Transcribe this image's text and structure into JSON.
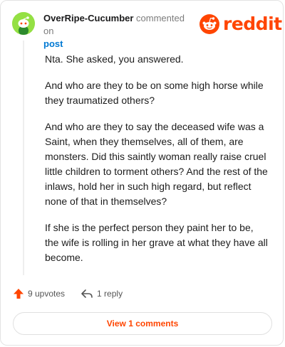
{
  "comment": {
    "author": "OverRipe-Cucumber",
    "action_text": "commented on",
    "post_link": "post",
    "paragraphs": [
      "Nta. She asked, you answered.",
      "And who are they to be on some high horse while they traumatized others?",
      "And who are they to say the deceased wife was a Saint, when they themselves, all of them, are monsters. Did this saintly woman really raise cruel little children to torment others? And the rest of the inlaws, hold her in such high regard, but reflect none of that in themselves?",
      "If she is the perfect person they paint her to be, the wife is rolling in her grave at what they have all become."
    ]
  },
  "brand": {
    "name": "reddit",
    "color": "#ff4500"
  },
  "footer": {
    "upvotes_label": "9 upvotes",
    "reply_label": "1 reply",
    "upvote_icon": "upvote-arrow-icon",
    "reply_icon": "reply-arrow-icon"
  },
  "view_comments_label": "View 1 comments",
  "colors": {
    "accent": "#ff4500",
    "avatar": "#94e044",
    "link": "#0079d3"
  }
}
